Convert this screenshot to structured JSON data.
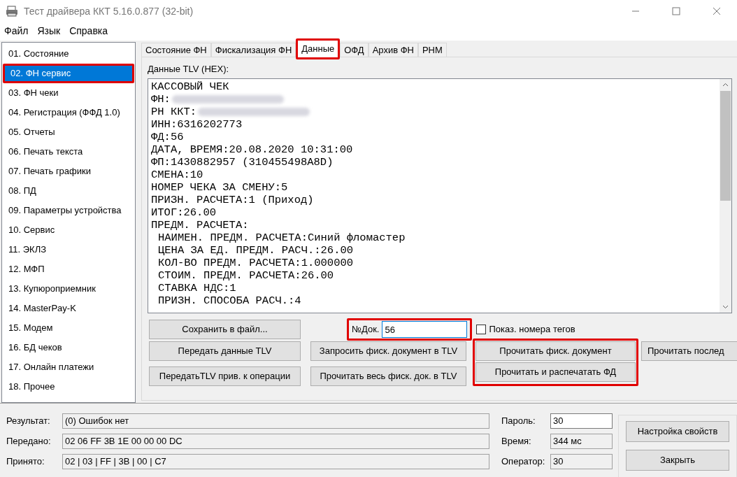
{
  "window": {
    "title": "Тест драйвера ККТ 5.16.0.877 (32-bit)"
  },
  "menu": [
    "Файл",
    "Язык",
    "Справка"
  ],
  "sidebar": {
    "items": [
      {
        "label": "01. Состояние",
        "selected": false,
        "highlighted": false
      },
      {
        "label": "02. ФН сервис",
        "selected": true,
        "highlighted": true
      },
      {
        "label": "03. ФН чеки",
        "selected": false,
        "highlighted": false
      },
      {
        "label": "04. Регистрация (ФФД 1.0)",
        "selected": false,
        "highlighted": false
      },
      {
        "label": "05. Отчеты",
        "selected": false,
        "highlighted": false
      },
      {
        "label": "06. Печать текста",
        "selected": false,
        "highlighted": false
      },
      {
        "label": "07. Печать графики",
        "selected": false,
        "highlighted": false
      },
      {
        "label": "08. ПД",
        "selected": false,
        "highlighted": false
      },
      {
        "label": "09. Параметры устройства",
        "selected": false,
        "highlighted": false
      },
      {
        "label": "10. Сервис",
        "selected": false,
        "highlighted": false
      },
      {
        "label": "11. ЭКЛЗ",
        "selected": false,
        "highlighted": false
      },
      {
        "label": "12. МФП",
        "selected": false,
        "highlighted": false
      },
      {
        "label": "13. Купюроприемник",
        "selected": false,
        "highlighted": false
      },
      {
        "label": "14. MasterPay-K",
        "selected": false,
        "highlighted": false
      },
      {
        "label": "15. Модем",
        "selected": false,
        "highlighted": false
      },
      {
        "label": "16. БД чеков",
        "selected": false,
        "highlighted": false
      },
      {
        "label": "17. Онлайн платежи",
        "selected": false,
        "highlighted": false
      },
      {
        "label": "18. Прочее",
        "selected": false,
        "highlighted": false
      }
    ]
  },
  "tabs": [
    {
      "label": "Состояние ФН",
      "selected": false,
      "highlighted": false
    },
    {
      "label": "Фискализация ФН",
      "selected": false,
      "highlighted": false
    },
    {
      "label": "Данные",
      "selected": true,
      "highlighted": true
    },
    {
      "label": "ОФД",
      "selected": false,
      "highlighted": false
    },
    {
      "label": "Архив ФН",
      "selected": false,
      "highlighted": false
    },
    {
      "label": "РНМ",
      "selected": false,
      "highlighted": false
    }
  ],
  "tlv": {
    "label": "Данные TLV (HEX):",
    "lines": [
      {
        "text": "КАССОВЫЙ ЧЕК",
        "redacted": false
      },
      {
        "text": "ФН:",
        "redacted": true
      },
      {
        "text": "РН ККТ:",
        "redacted": true
      },
      {
        "text": "ИНН:6316202773",
        "redacted": false
      },
      {
        "text": "ФД:56",
        "redacted": false
      },
      {
        "text": "ДАТА, ВРЕМЯ:20.08.2020 10:31:00",
        "redacted": false
      },
      {
        "text": "ФП:1430882957 (310455498A8D)",
        "redacted": false
      },
      {
        "text": "СМЕНА:10",
        "redacted": false
      },
      {
        "text": "НОМЕР ЧЕКА ЗА СМЕНУ:5",
        "redacted": false
      },
      {
        "text": "ПРИЗН. РАСЧЕТА:1 (Приход)",
        "redacted": false
      },
      {
        "text": "ИТОГ:26.00",
        "redacted": false
      },
      {
        "text": "ПРЕДМ. РАСЧЕТА:",
        "redacted": false,
        "children": [
          {
            "text": "НАИМЕН. ПРЕДМ. РАСЧЕТА:Синий фломастер",
            "redacted": false
          },
          {
            "text": "ЦЕНА ЗА ЕД. ПРЕДМ. РАСЧ.:26.00",
            "redacted": false
          },
          {
            "text": "КОЛ-ВО ПРЕДМ. РАСЧЕТА:1.000000",
            "redacted": false
          },
          {
            "text": "СТОИМ. ПРЕДМ. РАСЧЕТА:26.00",
            "redacted": false
          },
          {
            "text": "СТАВКА НДС:1",
            "redacted": false
          },
          {
            "text": "ПРИЗН. СПОСОБА РАСЧ.:4",
            "redacted": false
          }
        ]
      }
    ]
  },
  "save_button": "Сохранить в файл...",
  "doc_field": {
    "label": "№Док.",
    "value": "56",
    "highlighted": true
  },
  "show_tags": {
    "label": "Показ. номера тегов",
    "checked": false
  },
  "action_columns": [
    {
      "highlighted": false,
      "buttons": [
        "Передать данные TLV",
        "ПередатьTLV прив. к операции"
      ]
    },
    {
      "highlighted": false,
      "buttons": [
        "Запросить фиск. документ в TLV",
        "Прочитать весь фиск. док. в TLV"
      ]
    },
    {
      "highlighted": true,
      "buttons": [
        "Прочитать фиск. документ",
        "Прочитать и распечатать ФД"
      ]
    },
    {
      "highlighted": false,
      "buttons": [
        "Прочитать послед"
      ]
    }
  ],
  "status": {
    "fields": [
      {
        "label": "Результат:",
        "value": "(0) Ошибок нет"
      },
      {
        "label": "Передано:",
        "value": "02 06 FF 3B 1E 00 00 00 DC"
      },
      {
        "label": "Принято:",
        "value": "02 | 03 | FF | 3B | 00 | C7"
      }
    ],
    "side_fields": [
      {
        "label": "Пароль:",
        "value": "30",
        "editable": true
      },
      {
        "label": "Время:",
        "value": "344 мс",
        "editable": false
      },
      {
        "label": "Оператор:",
        "value": "30",
        "editable": false
      }
    ],
    "buttons": [
      "Настройка свойств",
      "Закрыть"
    ]
  }
}
